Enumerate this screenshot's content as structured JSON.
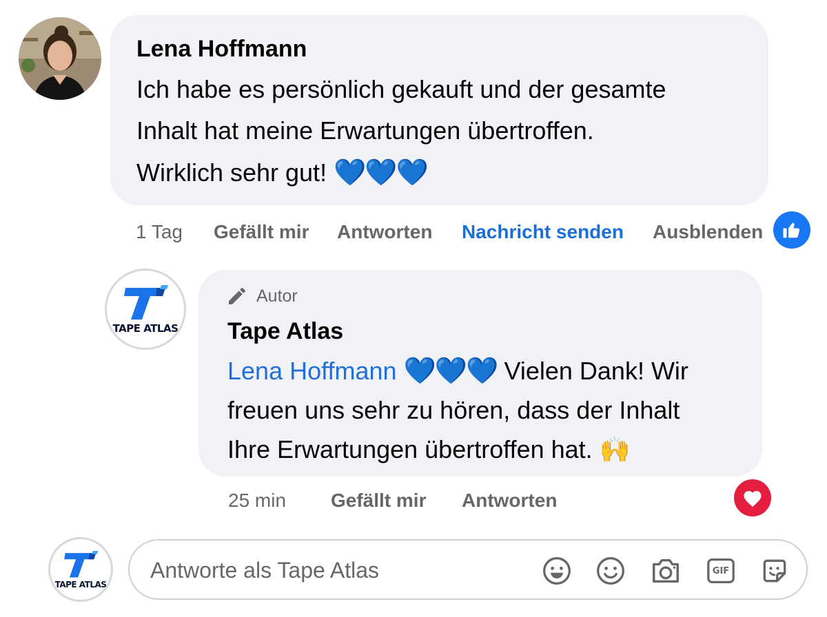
{
  "comment": {
    "author": "Lena Hoffmann",
    "lines": [
      "Ich habe es persönlich gekauft und der gesamte",
      "Inhalt hat meine Erwartungen übertroffen.",
      "Wirklich sehr gut!"
    ],
    "hearts": "💙💙💙",
    "actions": {
      "time": "1 Tag",
      "like": "Gefällt mir",
      "reply": "Antworten",
      "message": "Nachricht senden",
      "hide": "Ausblenden"
    },
    "reaction_icon": "thumbs-up-icon"
  },
  "reply": {
    "badge": "Autor",
    "author": "Tape Atlas",
    "mention": "Lena Hoffmann",
    "hearts": "💙💙💙",
    "line1_rest": " Vielen Dank! Wir",
    "line2": "freuen uns sehr zu hören, dass der Inhalt",
    "line3": "Ihre Erwartungen übertroffen hat.",
    "raised_hands": "🙌",
    "actions": {
      "time": "25 min",
      "like": "Gefällt mir",
      "reply": "Antworten"
    },
    "reaction_icon": "heart-icon"
  },
  "brand": {
    "logo_text": "TAPE ATLAS",
    "accent": "#1877f2"
  },
  "composer": {
    "placeholder": "Antworte als Tape Atlas",
    "tools": [
      "sticker-smile-icon",
      "emoji-icon",
      "camera-icon",
      "gif-icon",
      "sticker-icon"
    ],
    "gif_label": "GIF"
  }
}
